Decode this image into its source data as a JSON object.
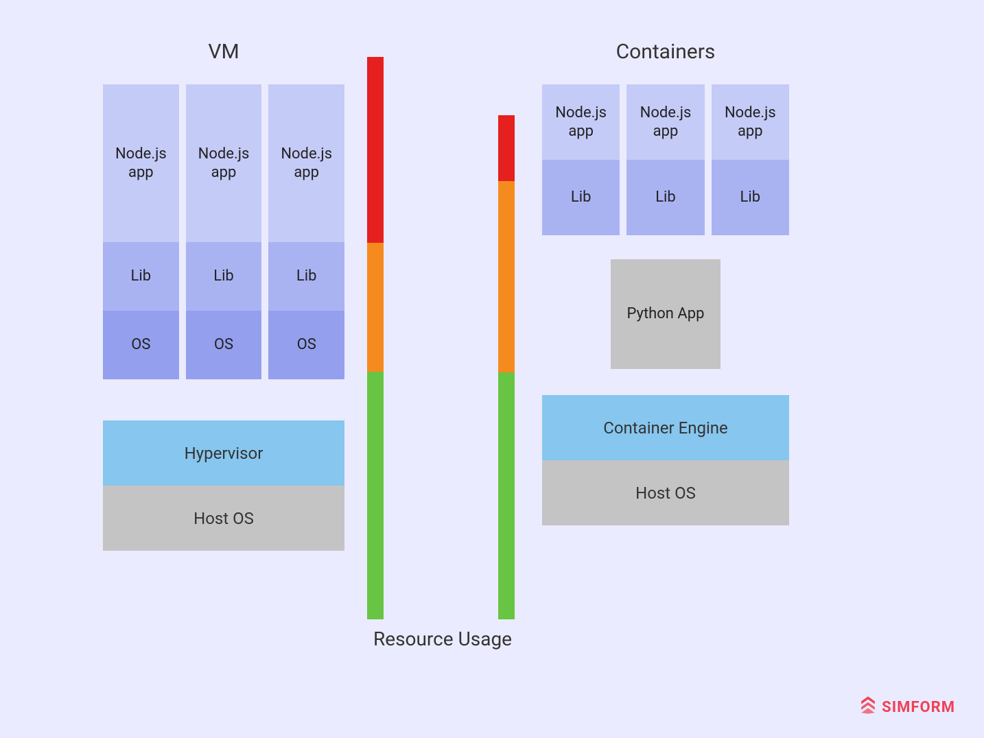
{
  "titles": {
    "vm": "VM",
    "containers": "Containers",
    "resource_usage": "Resource Usage"
  },
  "vm": {
    "apps": [
      "Node.js app",
      "Node.js app",
      "Node.js app"
    ],
    "libs": [
      "Lib",
      "Lib",
      "Lib"
    ],
    "oses": [
      "OS",
      "OS",
      "OS"
    ],
    "hypervisor": "Hypervisor",
    "host_os": "Host OS"
  },
  "containers": {
    "apps": [
      "Node.js app",
      "Node.js app",
      "Node.js app"
    ],
    "libs": [
      "Lib",
      "Lib",
      "Lib"
    ],
    "python_app": "Python App",
    "engine": "Container Engine",
    "host_os": "Host OS"
  },
  "resource_bars": {
    "vm": {
      "green_pct": 44,
      "orange_pct": 23,
      "red_pct": 33
    },
    "containers": {
      "green_pct": 49,
      "orange_pct": 38,
      "red_pct": 13
    }
  },
  "branding": {
    "name": "SIMFORM"
  },
  "colors": {
    "bg": "#ebebff",
    "app": "#c5cbf7",
    "lib": "#aab3f2",
    "os": "#949fed",
    "gray": "#c4c4c4",
    "blue": "#87c6ee",
    "green": "#68c544",
    "orange": "#f58b1f",
    "red": "#e5201f",
    "brand": "#ef4155"
  },
  "chart_data": {
    "type": "bar",
    "title": "Resource Usage",
    "categories": [
      "VM",
      "Containers"
    ],
    "series": [
      {
        "name": "green",
        "values": [
          44,
          49
        ]
      },
      {
        "name": "orange",
        "values": [
          23,
          38
        ]
      },
      {
        "name": "red",
        "values": [
          33,
          13
        ]
      }
    ],
    "note": "Values are approximate percentage heights of stacked color segments; bars represent relative resource usage (VM bar is taller overall)."
  }
}
